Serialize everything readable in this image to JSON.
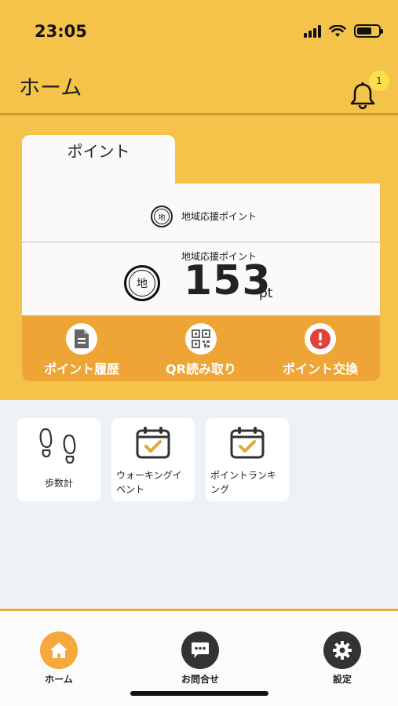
{
  "status_bar": {
    "time": "23:05"
  },
  "header": {
    "title": "ホーム",
    "notification_count": "1"
  },
  "points_card": {
    "tab_label": "ポイント",
    "badge_char": "地",
    "point_type_label": "地域応援ポイント",
    "balance_caption": "地域応援ポイント",
    "balance_value": "153",
    "balance_unit": "pt"
  },
  "actions": [
    {
      "label": "ポイント履歴",
      "icon": "document-icon"
    },
    {
      "label": "QR読み取り",
      "icon": "qr-code-icon"
    },
    {
      "label": "ポイント交換",
      "icon": "exclamation-icon"
    }
  ],
  "tiles": [
    {
      "label": "歩数計",
      "icon": "footprints-icon"
    },
    {
      "label": "ウォーキングイベント",
      "label_line1": "ウォーキングイ",
      "label_line2": "ベント",
      "icon": "calendar-check-icon"
    },
    {
      "label": "ポイントランキング",
      "label_line1": "ポイントランキ",
      "label_line2": "ング",
      "icon": "calendar-check-icon"
    }
  ],
  "tabbar": [
    {
      "label": "ホーム",
      "icon": "home-icon"
    },
    {
      "label": "お問合せ",
      "icon": "chat-icon"
    },
    {
      "label": "設定",
      "icon": "gear-icon"
    }
  ],
  "colors": {
    "header_bg": "#f5c34a",
    "action_bar": "#efa535",
    "content_bg": "#eef2f6",
    "alert_red": "#e0433a",
    "dark_icon": "#333333"
  }
}
